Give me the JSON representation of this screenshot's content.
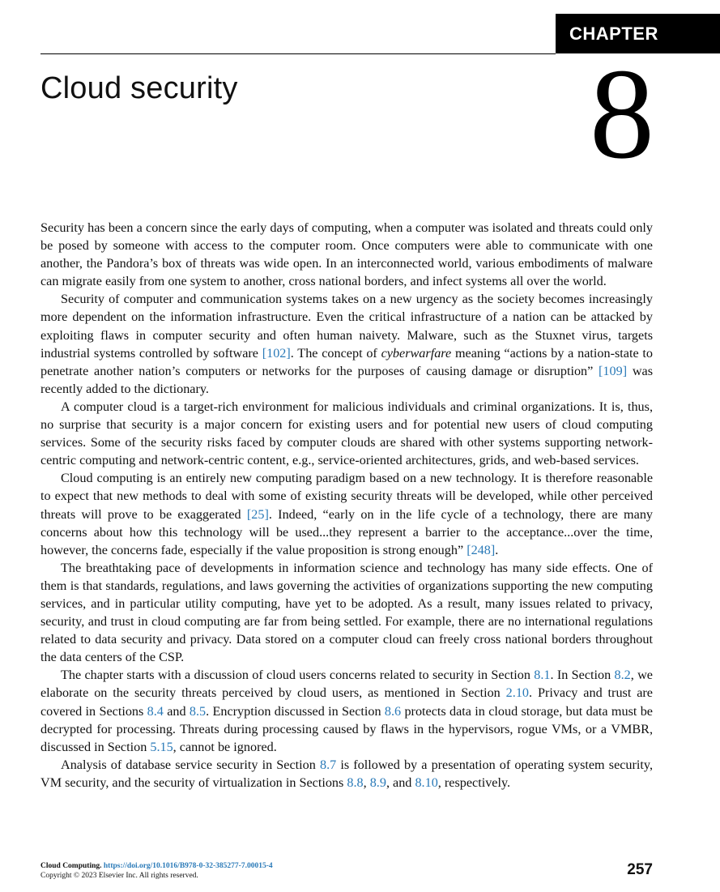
{
  "header": {
    "chapter_label": "CHAPTER",
    "chapter_number": "8",
    "title": "Cloud security"
  },
  "paragraphs": [
    [
      {
        "t": "Security has been a concern since the early days of computing, when a computer was isolated and threats could only be posed by someone with access to the computer room. Once computers were able to communicate with one another, the Pandora’s box of threats was wide open. In an interconnected world, various embodiments of malware can migrate easily from one system to another, cross national borders, and infect systems all over the world."
      }
    ],
    [
      {
        "t": "Security of computer and communication systems takes on a new urgency as the society becomes increasingly more dependent on the information infrastructure. Even the critical infrastructure of a na­tion can be attacked by exploiting flaws in computer security and often human naivety. Malware, such as the Stuxnet virus, targets industrial systems controlled by software "
      },
      {
        "t": "[102]",
        "ref": true
      },
      {
        "t": ". The concept of "
      },
      {
        "t": "cyberwar­fare",
        "em": true
      },
      {
        "t": " meaning “actions by a nation-state to penetrate another nation’s computers or networks for the purposes of causing damage or disruption” "
      },
      {
        "t": "[109]",
        "ref": true
      },
      {
        "t": " was recently added to the dictionary."
      }
    ],
    [
      {
        "t": "A computer cloud is a target-rich environment for malicious individuals and criminal organizations. It is, thus, no surprise that security is a major concern for existing users and for potential new users of cloud computing services. Some of the security risks faced by computer clouds are shared with other systems supporting network-centric computing and network-centric content, e.g., service-oriented architectures, grids, and web-based services."
      }
    ],
    [
      {
        "t": "Cloud computing is an entirely new computing paradigm based on a new technology. It is therefore reasonable to expect that new methods to deal with some of existing security threats will be developed, while other perceived threats will prove to be exaggerated "
      },
      {
        "t": "[25]",
        "ref": true
      },
      {
        "t": ". Indeed, “early on in the life cycle of a technology, there are many concerns about how this technology will be used...they represent a barrier to the acceptance...over the time, however, the concerns fade, especially if the value proposition is strong enough” "
      },
      {
        "t": "[248]",
        "ref": true
      },
      {
        "t": "."
      }
    ],
    [
      {
        "t": "The breathtaking pace of developments in information science and technology has many side ef­fects. One of them is that standards, regulations, and laws governing the activities of organizations supporting the new computing services, and in particular utility computing, have yet to be adopted. As a result, many issues related to privacy, security, and trust in cloud computing are far from being settled. For example, there are no international regulations related to data security and privacy. Data stored on a computer cloud can freely cross national borders throughout the data centers of the CSP."
      }
    ],
    [
      {
        "t": "The chapter starts with a discussion of cloud users concerns related to security in Section "
      },
      {
        "t": "8.1",
        "ref": true
      },
      {
        "t": ". In Section "
      },
      {
        "t": "8.2",
        "ref": true
      },
      {
        "t": ", we elaborate on the security threats perceived by cloud users, as mentioned in Section "
      },
      {
        "t": "2.10",
        "ref": true
      },
      {
        "t": ". Privacy and trust are covered in Sections "
      },
      {
        "t": "8.4",
        "ref": true
      },
      {
        "t": " and "
      },
      {
        "t": "8.5",
        "ref": true
      },
      {
        "t": ". Encryption discussed in Section "
      },
      {
        "t": "8.6",
        "ref": true
      },
      {
        "t": " protects data in cloud storage, but data must be decrypted for processing. Threats during processing caused by flaws in the hypervisors, rogue VMs, or a VMBR, discussed in Section "
      },
      {
        "t": "5.15",
        "ref": true
      },
      {
        "t": ", cannot be ignored."
      }
    ],
    [
      {
        "t": "Analysis of database service security in Section "
      },
      {
        "t": "8.7",
        "ref": true
      },
      {
        "t": " is followed by a presentation of operating system security, VM security, and the security of virtualization in Sections "
      },
      {
        "t": "8.8",
        "ref": true
      },
      {
        "t": ", "
      },
      {
        "t": "8.9",
        "ref": true
      },
      {
        "t": ", and "
      },
      {
        "t": "8.10",
        "ref": true
      },
      {
        "t": ", respectively."
      }
    ]
  ],
  "footer": {
    "book": "Cloud Computing.",
    "doi": "https://doi.org/10.1016/B978-0-32-385277-7.00015-4",
    "copyright": "Copyright © 2023 Elsevier Inc. All rights reserved.",
    "page_number": "257"
  },
  "colors": {
    "reference_link": "#2a7ab8",
    "chapter_tab_bg": "#000000"
  }
}
